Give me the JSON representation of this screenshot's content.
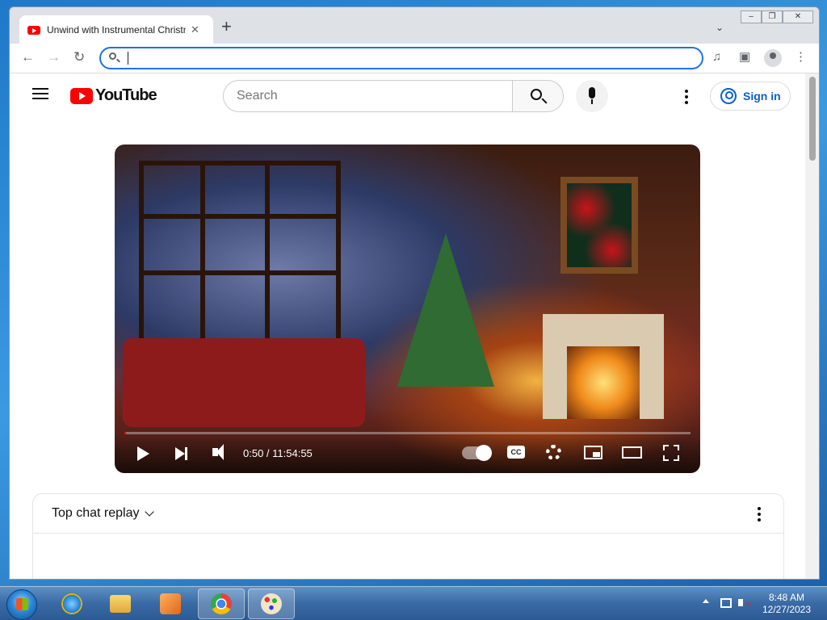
{
  "browser": {
    "tab_title": "Unwind with Instrumental Christmas",
    "new_tab_symbol": "+",
    "address_value": "",
    "nav": {
      "back": "←",
      "forward": "→",
      "reload": "↻"
    }
  },
  "youtube": {
    "logo_text": "YouTube",
    "search_placeholder": "Search",
    "sign_in_label": "Sign in"
  },
  "player": {
    "current_time": "0:50",
    "duration": "11:54:55",
    "time_display": "0:50 / 11:54:55",
    "progress_fraction": 0.0012,
    "cc_label": "CC",
    "icons": [
      "play-icon",
      "next-icon",
      "volume-icon",
      "autoplay-toggle-icon",
      "cc-icon",
      "settings-icon",
      "miniplayer-icon",
      "theater-icon",
      "fullscreen-icon"
    ]
  },
  "chat": {
    "title": "Top chat replay"
  },
  "taskbar": {
    "apps": [
      "start-button",
      "internet-explorer",
      "file-explorer",
      "media-player",
      "chrome",
      "paint"
    ],
    "active_app": "chrome",
    "clock_time": "8:48 AM",
    "clock_date": "12/27/2023"
  },
  "colors": {
    "youtube_red": "#ff0000",
    "link_blue": "#065fd4",
    "omnibox_focus": "#1a73e8"
  }
}
